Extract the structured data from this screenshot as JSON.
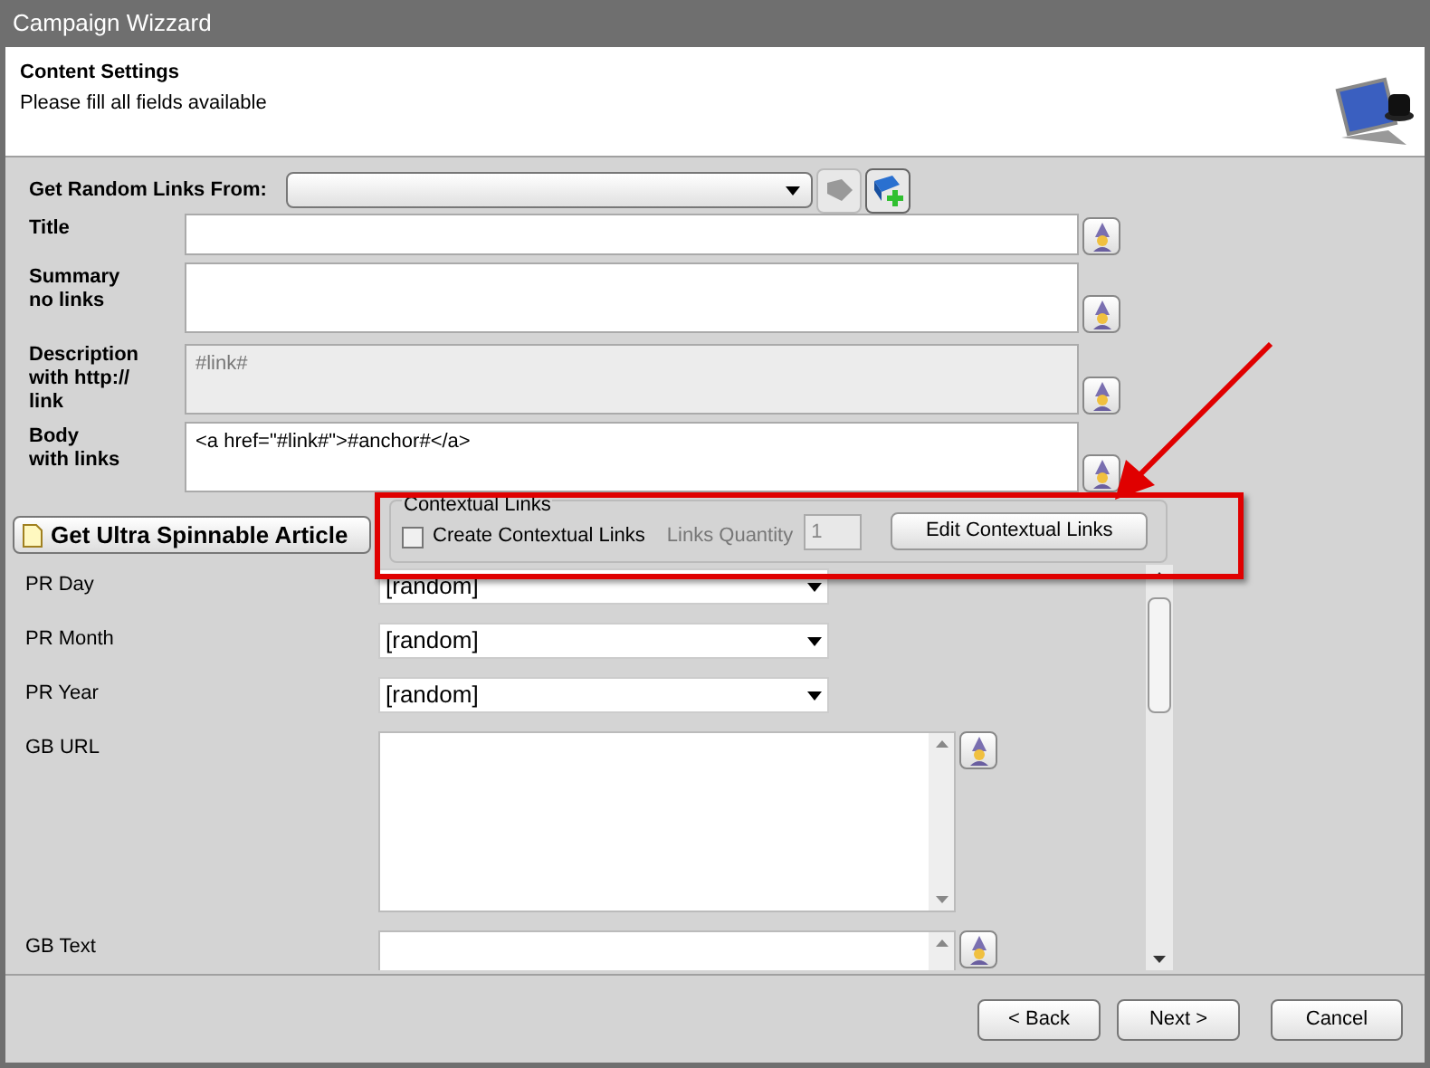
{
  "window": {
    "title": "Campaign Wizzard"
  },
  "header": {
    "title": "Content Settings",
    "subtitle": "Please fill all fields available"
  },
  "random_links": {
    "label": "Get Random Links From:"
  },
  "fields": [
    {
      "kind": "line",
      "label": "Title",
      "disabled": false
    },
    {
      "kind": "box",
      "label": "Summary\nno links",
      "disabled": false
    },
    {
      "kind": "box",
      "label": "Description\nwith http://\nlink",
      "value": "#link#",
      "disabled": true
    },
    {
      "kind": "box",
      "label": "Body\nwith links",
      "value": "<a href=\"#link#\">#anchor#</a>",
      "disabled": false
    }
  ],
  "spin_button": "Get Ultra Spinnable Article",
  "contextual_links": {
    "legend": "Contextual Links",
    "checkbox": {
      "label": "Create Contextual Links",
      "checked": false
    },
    "quantity": {
      "label": "Links Quantity",
      "value": "1",
      "disabled": true
    },
    "edit_button": "Edit Contextual Links"
  },
  "options": [
    {
      "kind": "select",
      "label": "PR Day",
      "value": "[random]"
    },
    {
      "kind": "select",
      "label": "PR Month",
      "value": "[random]"
    },
    {
      "kind": "select",
      "label": "PR Year",
      "value": "[random]"
    },
    {
      "kind": "textarea",
      "label": "GB URL"
    },
    {
      "kind": "textarea",
      "label": "GB Text"
    }
  ],
  "footer": {
    "buttons": [
      "< Back",
      "Next >",
      "Cancel"
    ]
  }
}
